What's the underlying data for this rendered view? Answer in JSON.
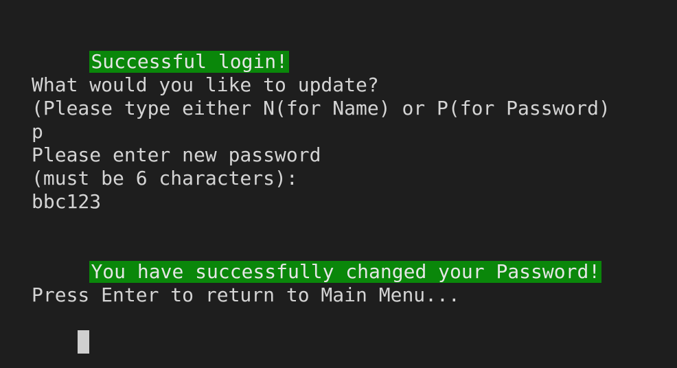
{
  "terminal": {
    "lines": [
      {
        "type": "highlight",
        "text": "Successful login!"
      },
      {
        "type": "blank",
        "text": ""
      },
      {
        "type": "text",
        "text": "What would you like to update?"
      },
      {
        "type": "text",
        "text": "(Please type either N(for Name) or P(for Password)"
      },
      {
        "type": "text",
        "text": "p"
      },
      {
        "type": "text",
        "text": "Please enter new password"
      },
      {
        "type": "text",
        "text": "(must be 6 characters):"
      },
      {
        "type": "text",
        "text": "bbc123"
      },
      {
        "type": "blank",
        "text": ""
      },
      {
        "type": "highlight",
        "text": "You have successfully changed your Password!"
      },
      {
        "type": "blank",
        "text": ""
      },
      {
        "type": "text",
        "text": "Press Enter to return to Main Menu..."
      }
    ],
    "colors": {
      "background": "#1e1e1e",
      "text": "#d4d4d4",
      "highlight_bg": "#0a870a",
      "cursor": "#cfcfcf"
    }
  }
}
